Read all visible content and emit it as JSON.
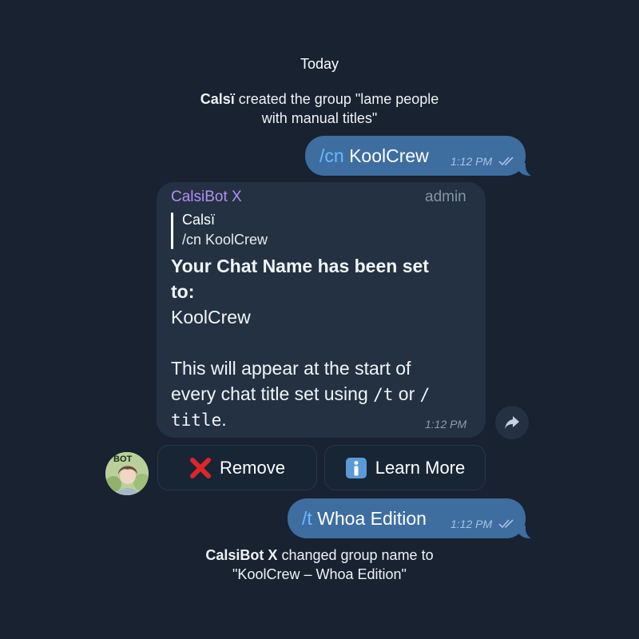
{
  "chat": {
    "date_label": "Today",
    "service_created": {
      "actor": "Calsï",
      "line1_rest": " created the group \"lame people",
      "line2": "with manual titles\""
    },
    "outgoing_1": {
      "command": "/cn",
      "text": " KoolCrew",
      "time": "1:12 PM"
    },
    "bot_message": {
      "sender": "CalsiBot X",
      "badge": "admin",
      "reply_to_name": "Calsï",
      "reply_to_text": "/cn KoolCrew",
      "heading_line1": "Your Chat Name has been set",
      "heading_line2": "to:",
      "name_value": "KoolCrew",
      "body_line1": "This will appear at the start of",
      "body_line2_pre": "every chat title set using ",
      "body_cmd1": "/t",
      "body_line2_mid": " or ",
      "body_cmd2_a": "/",
      "body_cmd2_b": "title",
      "body_line3_post": ".",
      "time": "1:12 PM"
    },
    "keyboard": {
      "remove_label": "Remove",
      "learn_more_label": "Learn More"
    },
    "avatar_badge": "BOT",
    "outgoing_2": {
      "command": "/t",
      "text": " Whoa Edition",
      "time": "1:12 PM"
    },
    "service_renamed": {
      "actor": "CalsiBot X",
      "line1_rest": " changed group name to",
      "line2": "\"KoolCrew – Whoa Edition\""
    }
  },
  "colors": {
    "background": "#182230",
    "outgoing_bubble": "#3e6da0",
    "incoming_bubble": "#233142",
    "sender_name": "#b48ef5",
    "command_link": "#6bb8ff"
  }
}
